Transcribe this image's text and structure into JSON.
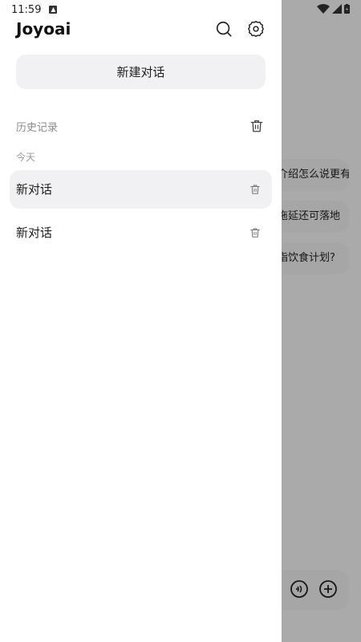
{
  "status_bar": {
    "time": "11:59"
  },
  "app": {
    "title": "Joyoai"
  },
  "drawer": {
    "new_chat_label": "新建对话",
    "history_title": "历史记录",
    "groups": [
      {
        "label": "今天",
        "conversations": [
          {
            "title": "新对话",
            "selected": true
          },
          {
            "title": "新对话",
            "selected": false
          }
        ]
      }
    ]
  },
  "background_chat": {
    "suggestions": [
      "介绍怎么说更有",
      "拖延还可落地",
      "指饮食计划?"
    ]
  },
  "colors": {
    "drawer_bg": "#ffffff",
    "item_selected_bg": "#f1f1f3",
    "muted_text": "#8a8a8e",
    "scrim": "rgba(0,0,0,0.30)"
  },
  "icons": {
    "header": [
      "search-icon",
      "gear-icon"
    ],
    "item_action": "trash-icon",
    "composer": [
      "voice-icon",
      "plus-circle-icon"
    ],
    "status": [
      "notification-a-icon",
      "wifi-icon",
      "signal-icon",
      "battery-icon"
    ]
  }
}
